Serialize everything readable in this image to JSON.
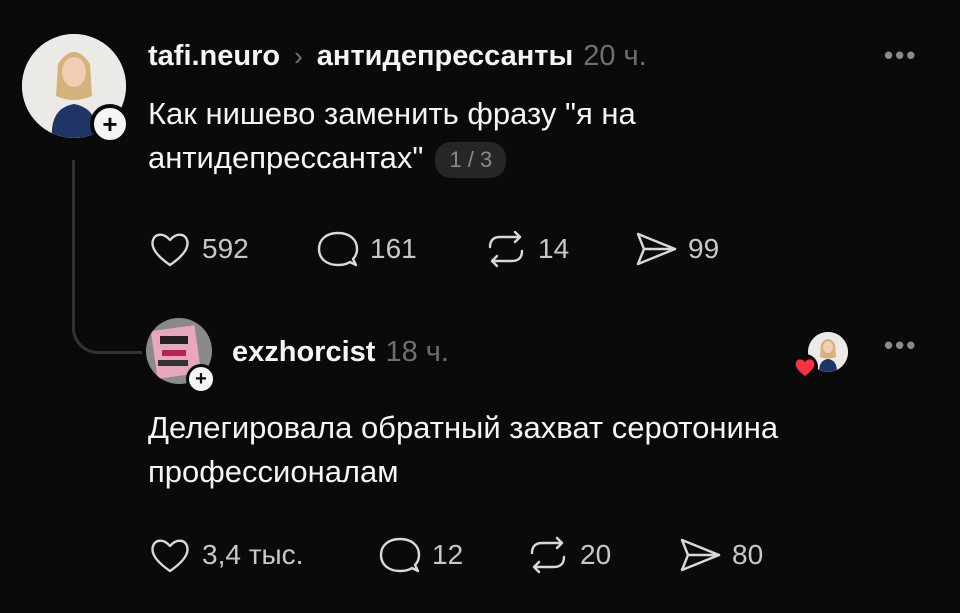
{
  "post": {
    "username": "tafi.neuro",
    "community": "антидепрессанты",
    "time": "20 ч.",
    "text": "Как нишево заменить фразу \"я на антидепрессантах\"",
    "page_indicator": "1 / 3",
    "stats": {
      "likes": "592",
      "comments": "161",
      "reposts": "14",
      "shares": "99"
    }
  },
  "reply": {
    "username": "exzhorcist",
    "time": "18 ч.",
    "text": "Делегировала обратный захват серотонина профессионалам",
    "stats": {
      "likes": "3,4 тыс.",
      "comments": "12",
      "reposts": "20",
      "shares": "80"
    }
  },
  "colors": {
    "background": "#0a0a0a",
    "text": "#f3f5f7",
    "muted": "#6f6f6f",
    "heart": "#ff3040"
  },
  "icons": [
    "plus-icon",
    "chevron-right-icon",
    "more-icon",
    "heart-icon",
    "comment-icon",
    "repost-icon",
    "share-icon"
  ]
}
